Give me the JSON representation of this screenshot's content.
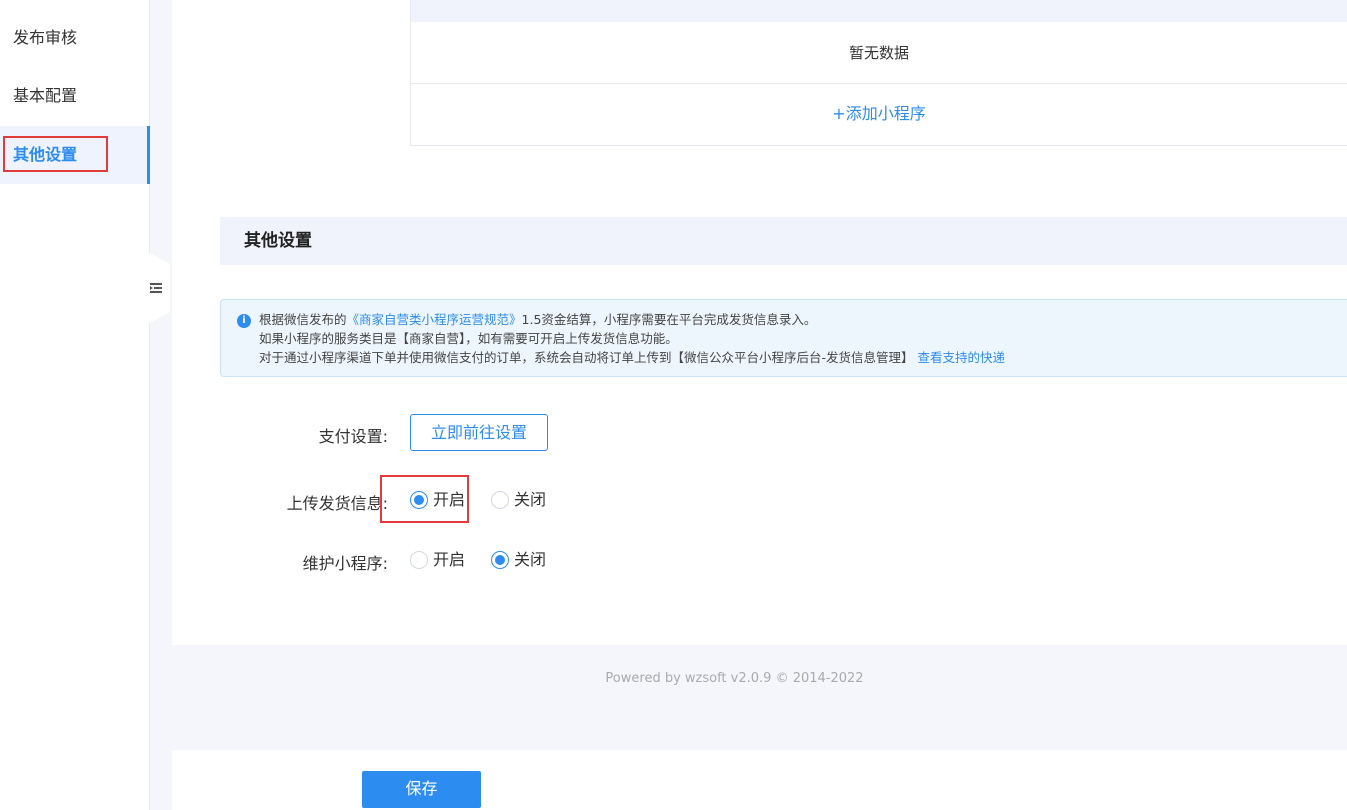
{
  "sidebar": {
    "items": [
      {
        "label": "发布审核",
        "active": false
      },
      {
        "label": "基本配置",
        "active": false
      },
      {
        "label": "其他设置",
        "active": true
      }
    ]
  },
  "table": {
    "empty_text": "暂无数据",
    "add_label": "+添加小程序"
  },
  "section": {
    "title": "其他设置"
  },
  "notice": {
    "icon": "info-icon",
    "line1_prefix": "根据微信发布的",
    "line1_link": "《商家自营类小程序运营规范》",
    "line1_suffix": "1.5资金结算，小程序需要在平台完成发货信息录入。",
    "line2": "如果小程序的服务类目是【商家自营】，如有需要可开启上传发货信息功能。",
    "line3": "对于通过小程序渠道下单并使用微信支付的订单，系统会自动将订单上传到【微信公众平台小程序后台-发货信息管理】",
    "line3_link": "查看支持的快递"
  },
  "form": {
    "payment": {
      "label": "支付设置:",
      "button": "立即前往设置"
    },
    "upload_shipping": {
      "label": "上传发货信息:",
      "options": [
        "开启",
        "关闭"
      ],
      "selected": "开启"
    },
    "maintain_miniprogram": {
      "label": "维护小程序:",
      "options": [
        "开启",
        "关闭"
      ],
      "selected": "关闭"
    }
  },
  "footer": {
    "text": "Powered by wzsoft v2.0.9 © 2014-2022"
  },
  "actions": {
    "save_label": "保存"
  },
  "colors": {
    "primary": "#2d8cf0",
    "highlight": "#e23b3b"
  }
}
